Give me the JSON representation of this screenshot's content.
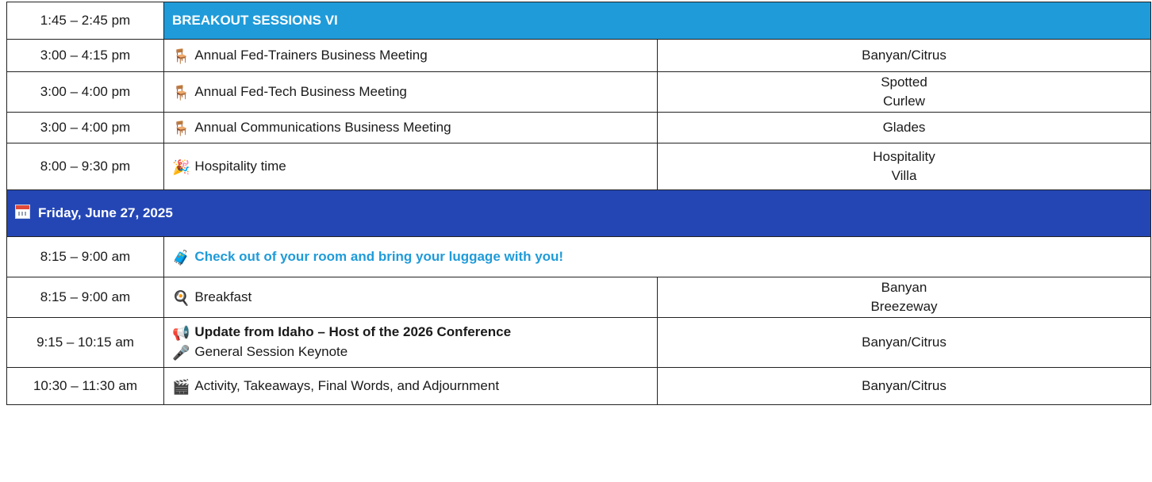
{
  "rows": [
    {
      "time": "1:45 – 2:45 pm",
      "banner": "BREAKOUT SESSIONS VI"
    },
    {
      "time": "3:00 – 4:15 pm",
      "icon": "chair-icon",
      "event": "Annual Fed-Trainers Business Meeting",
      "room": "Banyan/Citrus"
    },
    {
      "time": "3:00 – 4:00 pm",
      "icon": "chair-icon",
      "event": "Annual Fed-Tech Business Meeting",
      "room_line1": "Spotted",
      "room_line2": "Curlew"
    },
    {
      "time": "3:00 – 4:00 pm",
      "icon": "chair-icon",
      "event": "Annual Communications Business Meeting",
      "room": "Glades"
    },
    {
      "time": "8:00 – 9:30 pm",
      "icon": "party-popper-icon",
      "event": "Hospitality time",
      "room_line1": "Hospitality",
      "room_line2": "Villa"
    }
  ],
  "day": {
    "icon": "calendar-icon",
    "label": "Friday, June 27, 2025"
  },
  "friday": [
    {
      "time": "8:15 – 9:00 am",
      "icon": "luggage-icon",
      "event": "Check out of your room and bring your luggage with you!"
    },
    {
      "time": "8:15 – 9:00 am",
      "icon": "fried-egg-icon",
      "event": "Breakfast",
      "room_line1": "Banyan",
      "room_line2": "Breezeway"
    },
    {
      "time": "9:15 – 10:15 am",
      "icon": "megaphone-icon",
      "event": "Update from Idaho – Host of the 2026 Conference",
      "icon2": "microphone-icon",
      "event2": "General Session Keynote",
      "room": "Banyan/Citrus"
    },
    {
      "time": "10:30 – 11:30 am",
      "icon": "clapper-board-icon",
      "event": "Activity, Takeaways, Final Words, and Adjournment",
      "room": "Banyan/Citrus"
    }
  ]
}
